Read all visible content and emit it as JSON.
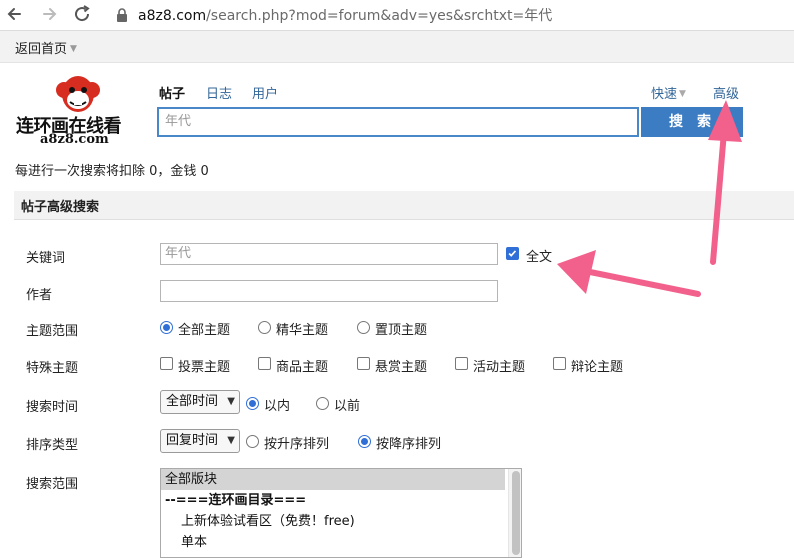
{
  "browser": {
    "url_host": "a8z8.com",
    "url_path": "/search.php?mod=forum&adv=yes&srchtxt=年代"
  },
  "topbar": {
    "back_home": "返回首页"
  },
  "logo": {
    "title": "连环画在线看",
    "domain": "a8z8.com"
  },
  "search": {
    "tabs": [
      "帖子",
      "日志",
      "用户"
    ],
    "fast_label": "快速",
    "advanced_label": "高级",
    "query": "年代",
    "button_label": "搜索"
  },
  "notice": "每进行一次搜索将扣除 0，金钱 0",
  "section_title": "帖子高级搜索",
  "form": {
    "keyword_label": "关键词",
    "keyword_value": "年代",
    "fulltext_label": "全文",
    "author_label": "作者",
    "author_value": "",
    "scope_label": "主题范围",
    "scope_options": [
      "全部主题",
      "精华主题",
      "置顶主题"
    ],
    "special_label": "特殊主题",
    "special_options": [
      "投票主题",
      "商品主题",
      "悬赏主题",
      "活动主题",
      "辩论主题"
    ],
    "time_label": "搜索时间",
    "time_select": "全部时间",
    "time_options": [
      "以内",
      "以前"
    ],
    "order_label": "排序类型",
    "order_select": "回复时间",
    "order_options": [
      "按升序排列",
      "按降序排列"
    ],
    "range_label": "搜索范围",
    "range_items": [
      "全部版块",
      "--===连环画目录===",
      "上新体验试看区（免费！free)",
      "单本"
    ]
  },
  "colors": {
    "accent": "#3b7cc2",
    "annotation_arrow": "#f2608c"
  }
}
